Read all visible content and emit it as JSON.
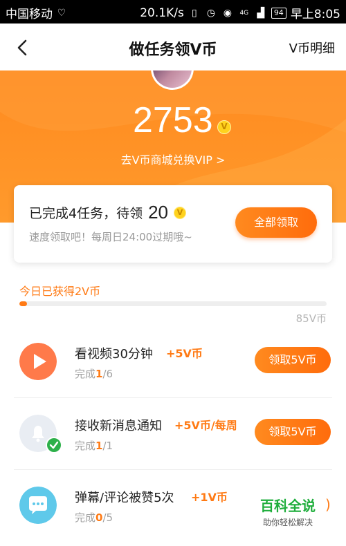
{
  "status_bar": {
    "carrier": "中国移动",
    "speed": "20.1K/s",
    "battery": "94",
    "time": "早上8:05",
    "network": "4G"
  },
  "nav": {
    "title": "做任务领V币",
    "right_link": "V币明细"
  },
  "header": {
    "coin_total": "2753",
    "coin_symbol": "V",
    "exchange_link": "去V币商城兑换VIP >"
  },
  "summary": {
    "line1_prefix": "已完成4任务，待领",
    "pending": "20",
    "coin_symbol": "V",
    "subtitle": "速度领取吧！每周日24:00过期哦~",
    "claim_all": "全部领取"
  },
  "progress": {
    "label": "今日已获得2V币",
    "max_label": "85V币",
    "earned": 2,
    "max": 85
  },
  "tasks": [
    {
      "icon": "play-icon",
      "title": "看视频30分钟",
      "reward": "+5V币",
      "done": "1",
      "total": "6",
      "progress_prefix": "完成",
      "button": "领取5V币"
    },
    {
      "icon": "bell-icon",
      "title": "接收新消息通知",
      "reward": "+5V币/每周",
      "done": "1",
      "total": "1",
      "progress_prefix": "完成",
      "button": "领取5V币"
    },
    {
      "icon": "chat-bubble-icon",
      "title": "弹幕/评论被赞5次",
      "reward": "+1V币",
      "done": "0",
      "total": "5",
      "progress_prefix": "完成",
      "button": ""
    }
  ],
  "watermark": {
    "main": "百科全说",
    "sub": "助你轻松解决"
  },
  "colors": {
    "accent": "#ff7a14",
    "header": "#ff8a1f",
    "watermark": "#1fae3c"
  }
}
